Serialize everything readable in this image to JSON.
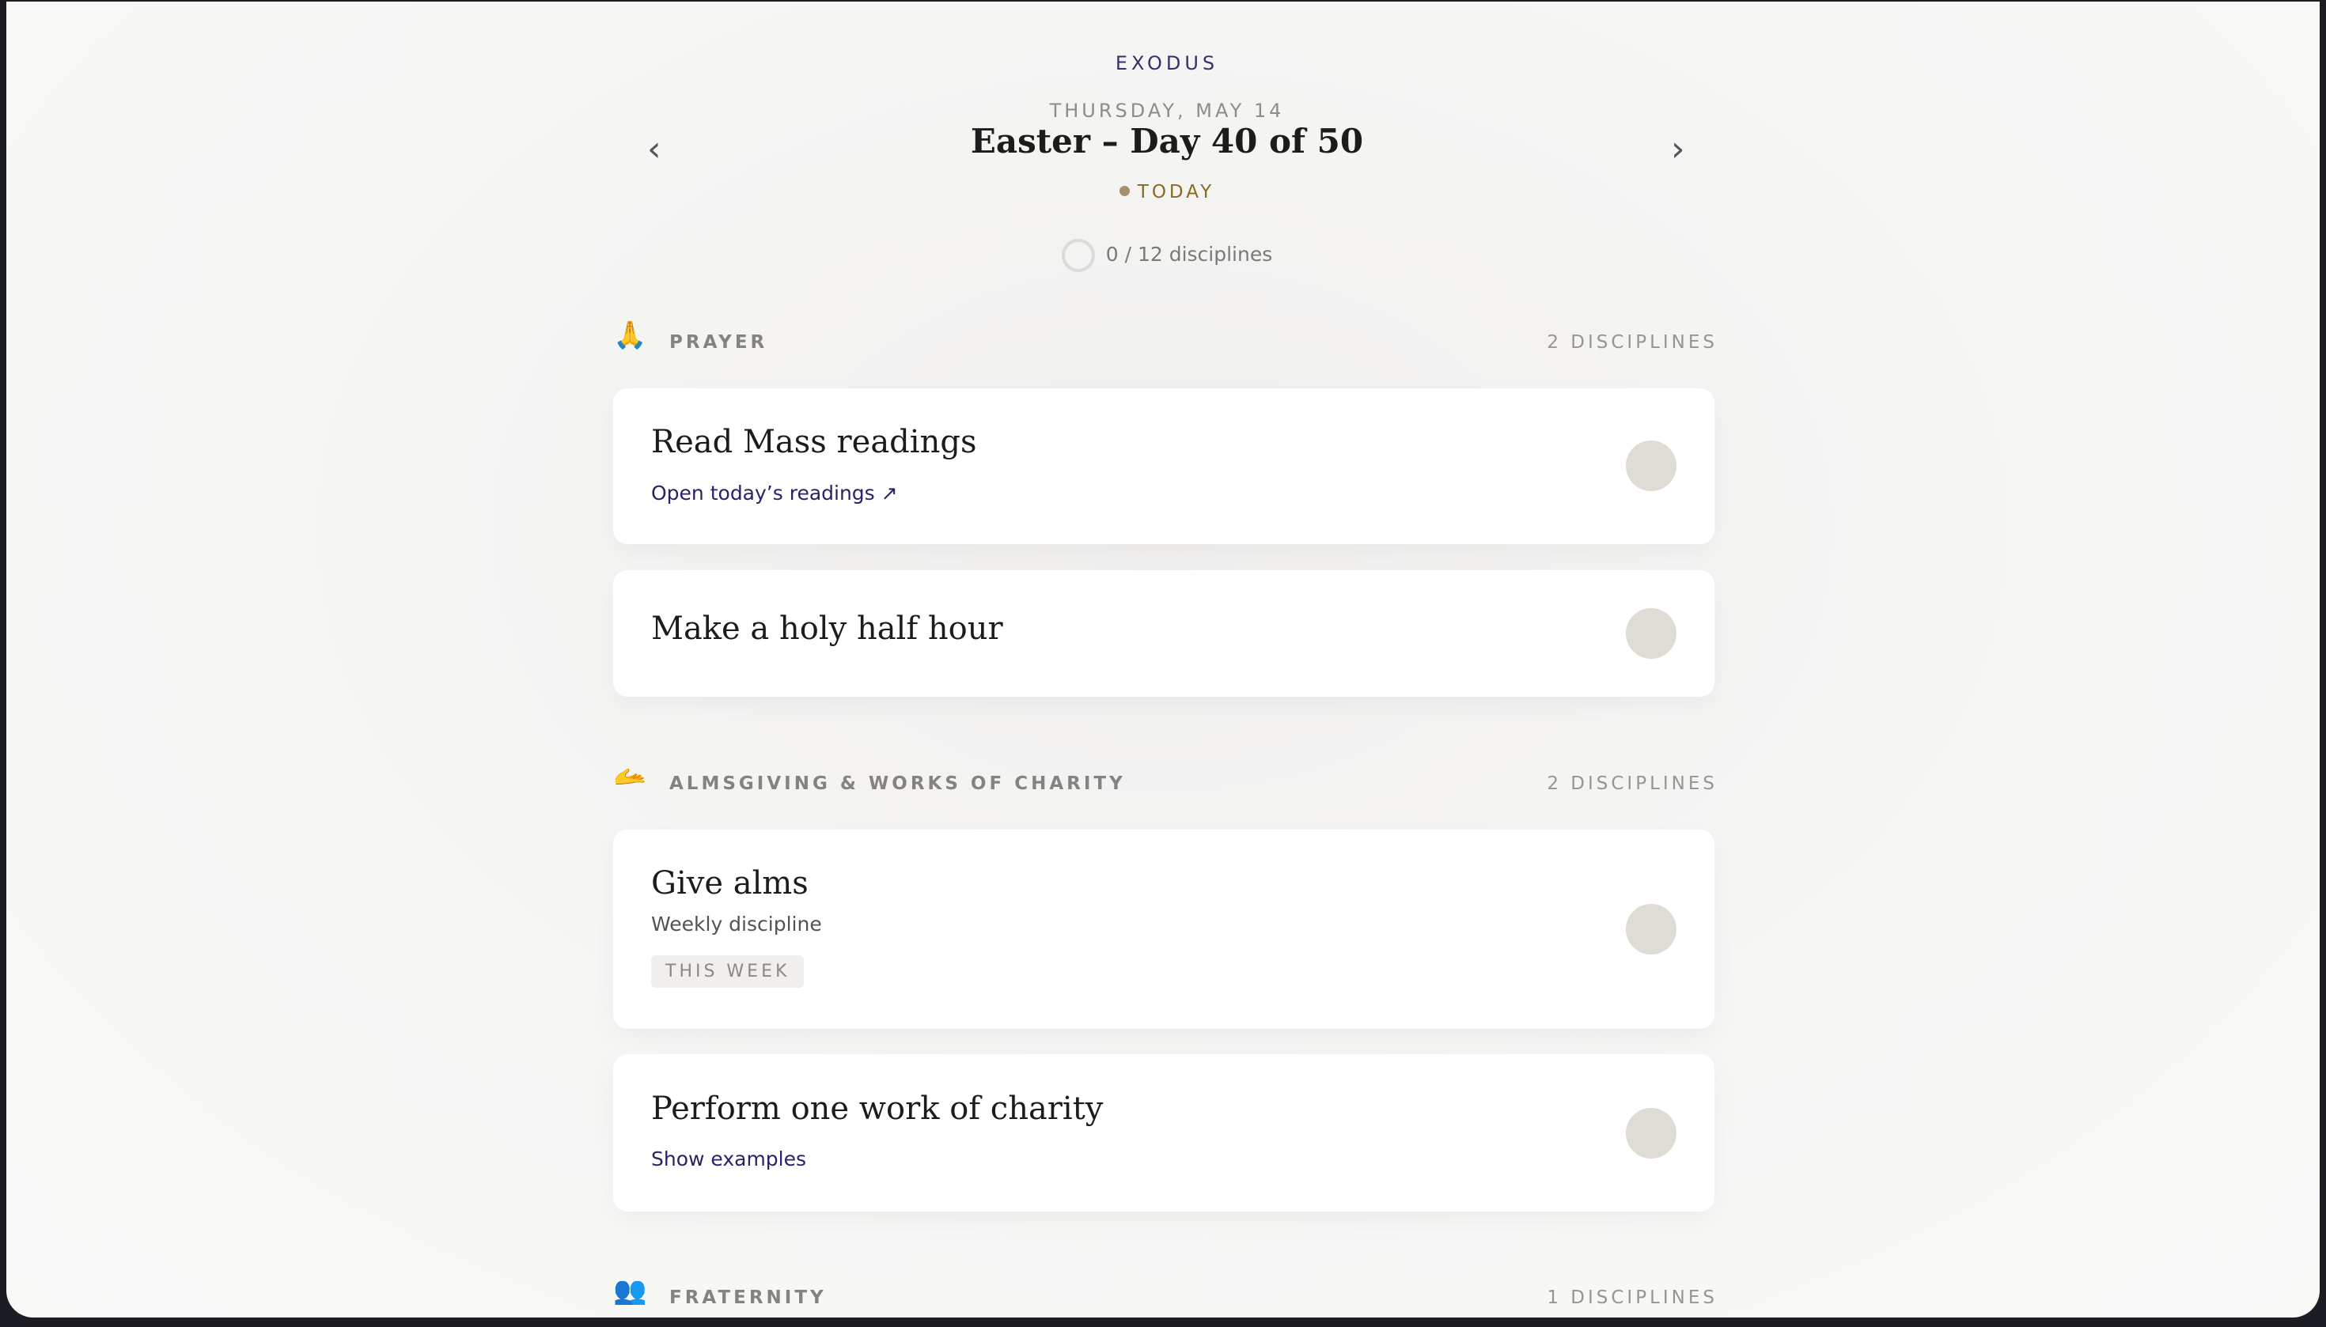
{
  "app": {
    "name": "EXODUS"
  },
  "header": {
    "date": "THURSDAY, MAY 14",
    "season": "Easter – Day 40 of 50",
    "today_label": "TODAY",
    "prev_icon": "chevron-left-icon",
    "next_icon": "chevron-right-icon",
    "prev_glyph": "‹",
    "next_glyph": "›"
  },
  "progress": {
    "text": "0 / 12 disciplines",
    "completed": 0,
    "total": 12
  },
  "sections": [
    {
      "icon": "praying-hands-icon",
      "emoji": "🙏",
      "title": "PRAYER",
      "count": "2 DISCIPLINES",
      "items": [
        {
          "title": "Read Mass readings",
          "link": "Open today’s readings ↗"
        },
        {
          "title": "Make a holy half hour"
        }
      ]
    },
    {
      "icon": "giving-hand-icon",
      "emoji": "🫴",
      "title": "ALMSGIVING & WORKS OF CHARITY",
      "count": "2 DISCIPLINES",
      "items": [
        {
          "title": "Give alms",
          "subtitle": "Weekly discipline",
          "badge": "THIS WEEK"
        },
        {
          "title": "Perform one work of charity",
          "link": "Show examples"
        }
      ]
    },
    {
      "icon": "people-icon",
      "emoji": "👥",
      "title": "FRATERNITY",
      "count": "1 DISCIPLINES",
      "items": []
    }
  ],
  "colors": {
    "accent": "#2e2067",
    "today": "#8a6a22",
    "check": "#dfdcd6",
    "background": "#f5f5f4"
  }
}
